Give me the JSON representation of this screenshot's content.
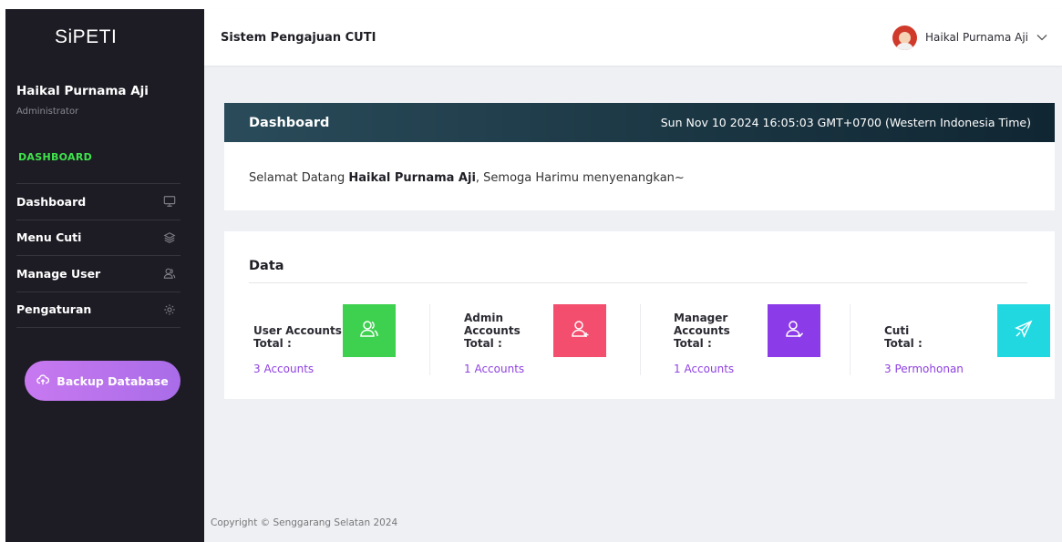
{
  "sidebar": {
    "brand": "SiPETI",
    "user_name": "Haikal Purnama Aji",
    "user_role": "Administrator",
    "section_title": "DASHBOARD",
    "items": [
      {
        "label": "Dashboard",
        "icon": "monitor-icon"
      },
      {
        "label": "Menu Cuti",
        "icon": "layers-icon"
      },
      {
        "label": "Manage User",
        "icon": "users-icon"
      },
      {
        "label": "Pengaturan",
        "icon": "gear-icon"
      }
    ],
    "backup_label": "Backup Database"
  },
  "topbar": {
    "title": "Sistem Pengajuan CUTI",
    "account_name": "Haikal Purnama Aji"
  },
  "dashboard": {
    "title": "Dashboard",
    "datetime": "Sun Nov 10 2024 16:05:03 GMT+0700 (Western Indonesia Time)",
    "welcome_prefix": "Selamat Datang ",
    "welcome_name": "Haikal Purnama Aji",
    "welcome_suffix": ", Semoga Harimu menyenangkan~"
  },
  "data": {
    "title": "Data",
    "stats": [
      {
        "label_line1": "User Accounts",
        "label_line2": "",
        "total": "Total :",
        "value": "3 Accounts",
        "color": "#3dd14f",
        "icon": "users-icon"
      },
      {
        "label_line1": "Admin",
        "label_line2": "Accounts",
        "total": "Total :",
        "value": "1 Accounts",
        "color": "#f44e6e",
        "icon": "user-add-icon"
      },
      {
        "label_line1": "Manager",
        "label_line2": "Accounts",
        "total": "Total :",
        "value": "1 Accounts",
        "color": "#8c3be8",
        "icon": "user-check-icon"
      },
      {
        "label_line1": "Cuti",
        "label_line2": "",
        "total": "Total :",
        "value": "3 Permohonan",
        "color": "#21d8e0",
        "icon": "airplane-icon"
      }
    ]
  },
  "footer": "Copyright © Senggarang Selatan 2024"
}
